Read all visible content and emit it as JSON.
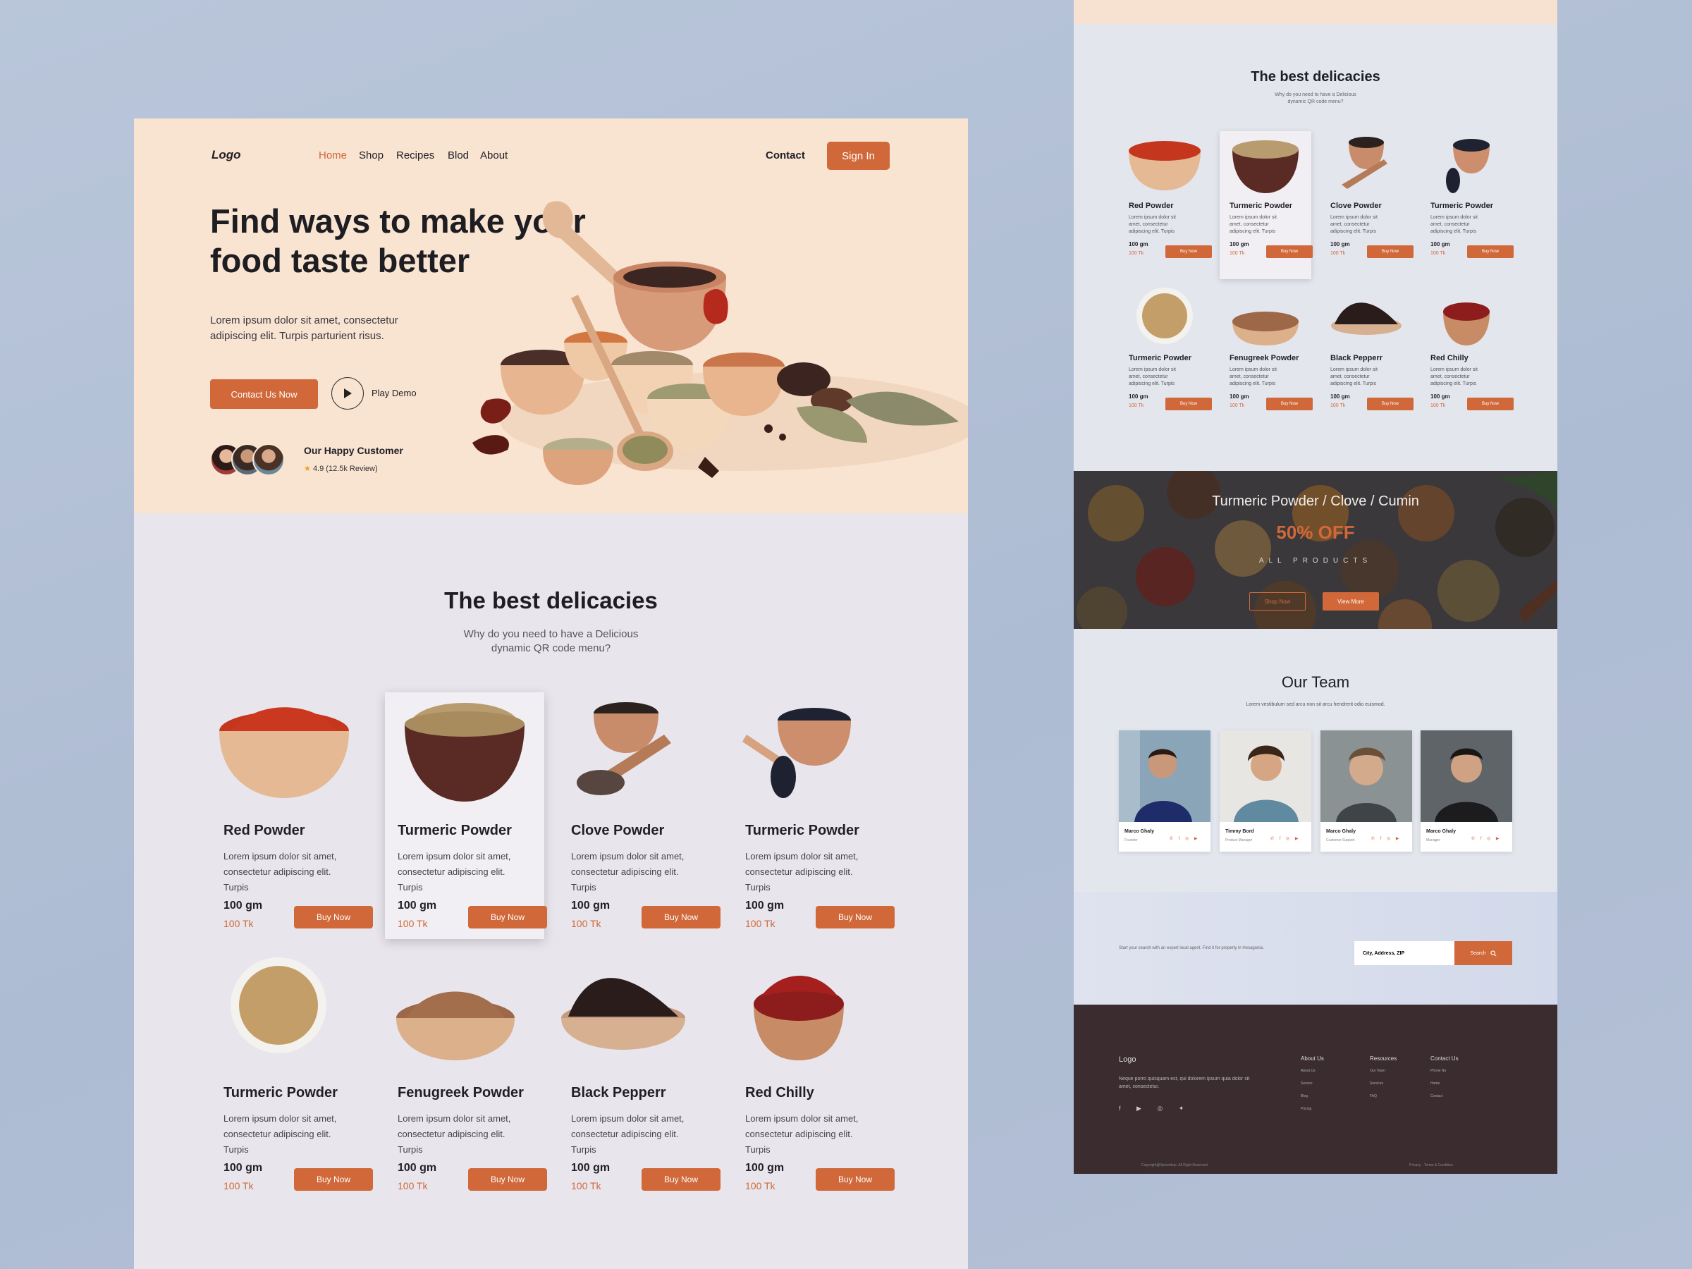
{
  "nav": {
    "logo": "Logo",
    "items": [
      "Home",
      "Shop",
      "Recipes",
      "Blod",
      "About"
    ],
    "contact": "Contact",
    "signin": "Sign In"
  },
  "hero": {
    "title": "Find  ways to make your\nfood taste better",
    "text": "Lorem ipsum dolor sit amet, consectetur adipiscing elit. Turpis parturient risus.",
    "contact_btn": "Contact Us Now",
    "play_label": "Play Demo",
    "customer_title": "Our Happy Customer",
    "rating": "4.9",
    "reviews": "(12.5k Review)"
  },
  "delicacies": {
    "title": "The best delicacies",
    "subtitle": "Why do you need to have a Delicious\ndynamic QR code menu?"
  },
  "products": [
    {
      "name": "Red Powder",
      "desc": "Lorem ipsum dolor sit amet, consectetur adipiscing elit. Turpis",
      "weight": "100 gm",
      "price": "100 Tk",
      "buy": "Buy Now"
    },
    {
      "name": "Turmeric Powder",
      "desc": "Lorem ipsum dolor sit amet, consectetur adipiscing elit. Turpis",
      "weight": "100 gm",
      "price": "100 Tk",
      "buy": "Buy Now"
    },
    {
      "name": "Clove Powder",
      "desc": "Lorem ipsum dolor sit amet, consectetur adipiscing elit. Turpis",
      "weight": "100 gm",
      "price": "100 Tk",
      "buy": "Buy Now"
    },
    {
      "name": "Turmeric Powder",
      "desc": "Lorem ipsum dolor sit amet, consectetur adipiscing elit. Turpis",
      "weight": "100 gm",
      "price": "100 Tk",
      "buy": "Buy Now"
    },
    {
      "name": "Turmeric Powder",
      "desc": "Lorem ipsum dolor sit amet, consectetur adipiscing elit. Turpis",
      "weight": "100 gm",
      "price": "100 Tk",
      "buy": "Buy Now"
    },
    {
      "name": "Fenugreek Powder",
      "desc": "Lorem ipsum dolor sit amet, consectetur adipiscing elit. Turpis",
      "weight": "100 gm",
      "price": "100 Tk",
      "buy": "Buy Now"
    },
    {
      "name": "Black Pepperr",
      "desc": "Lorem ipsum dolor sit amet, consectetur adipiscing elit. Turpis",
      "weight": "100 gm",
      "price": "100 Tk",
      "buy": "Buy Now"
    },
    {
      "name": "Red Chilly",
      "desc": "Lorem ipsum dolor sit amet, consectetur adipiscing elit. Turpis",
      "weight": "100 gm",
      "price": "100 Tk",
      "buy": "Buy Now"
    }
  ],
  "banner": {
    "title": "Turmeric Powder / Clove / Cumin",
    "offer": "50% OFF",
    "all": "ALL PRODUCTS",
    "shop": "Shop Now",
    "view": "View More"
  },
  "team": {
    "title": "Our Team",
    "subtitle": "Lorem vestibulum sed arcu non sit arcu hendrerit odio euismod.",
    "members": [
      {
        "name": "Marco Ghaly",
        "role": "Founder"
      },
      {
        "name": "Timmy Bord",
        "role": "Product Manager"
      },
      {
        "name": "Marco Ghaly",
        "role": "Customer Support"
      },
      {
        "name": "Marco Ghaly",
        "role": "Manager"
      }
    ]
  },
  "subscribe": {
    "text": "Start your search with an expert local agent. Find it for property in Hexagonia.",
    "input_value": "City, Address, ZIP",
    "button": "Search"
  },
  "footer": {
    "logo": "Logo",
    "text": "Neque porro quisquam est, qui dolorem ipsum quia dolor sit amet, consectetur.",
    "columns": [
      {
        "title": "About Us",
        "links": [
          "About Us",
          "Service",
          "Blog",
          "Pricing"
        ]
      },
      {
        "title": "Resources",
        "links": [
          "Our Team",
          "Services",
          "FAQ"
        ]
      },
      {
        "title": "Contact Us",
        "links": [
          "Phone No",
          "Home",
          "Contact"
        ]
      }
    ],
    "copyright": "Copyright@Spiceshop. All Right Reserved",
    "privacy": "Privacy · Terms & Condition"
  },
  "colors": {
    "accent": "#d0683a",
    "hero_bg": "#f9e3d1",
    "footer_bg": "#3a2c2f"
  }
}
